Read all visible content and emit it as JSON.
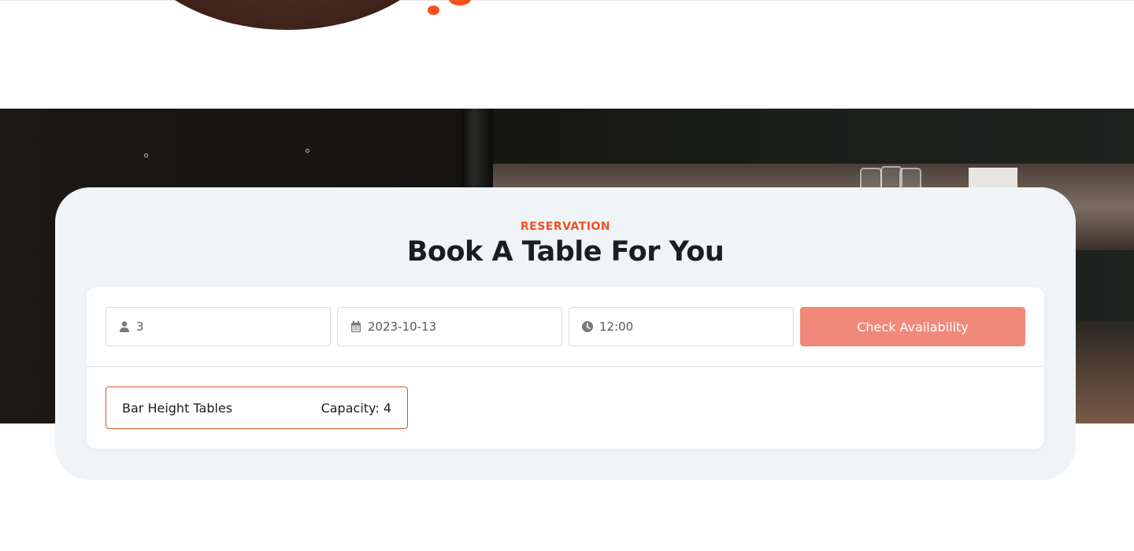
{
  "hero": {
    "accent_color": "#f4511e"
  },
  "reservation": {
    "eyebrow": "RESERVATION",
    "title": "Book A Table For You",
    "guests": {
      "value": "3",
      "icon": "user-icon"
    },
    "date": {
      "value": "2023-10-13",
      "icon": "calendar-icon"
    },
    "time": {
      "value": "12:00",
      "icon": "clock-icon"
    },
    "check_button_label": "Check Availability",
    "table_options": [
      {
        "name": "Bar Height Tables",
        "capacity": "Capacity: 4"
      }
    ]
  },
  "colors": {
    "accent": "#f4511e",
    "button": "#f0897a",
    "card_background": "#f0f4f7"
  }
}
